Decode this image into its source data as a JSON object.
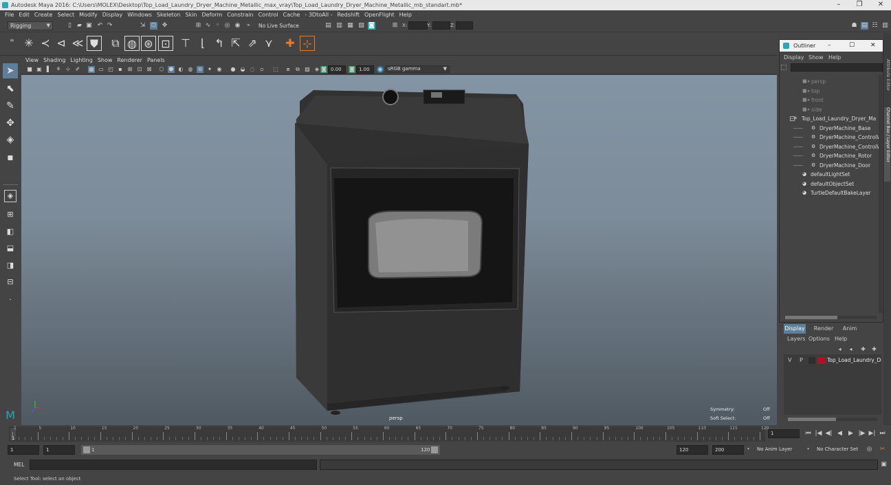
{
  "window": {
    "title": "Autodesk Maya 2016: C:\\Users\\MOLEX\\Desktop\\Top_Load_Laundry_Dryer_Machine_Metallic_max_vray\\Top_Load_Laundry_Dryer_Machine_Metallic_mb_standart.mb*"
  },
  "menu": [
    "File",
    "Edit",
    "Create",
    "Select",
    "Modify",
    "Display",
    "Windows",
    "Skeleton",
    "Skin",
    "Deform",
    "Constrain",
    "Control",
    "Cache",
    "- 3DtoAll -",
    "Redshift",
    "OpenFlight",
    "Help"
  ],
  "statusline": {
    "mode": "Rigging",
    "live_surface": "No Live Surface",
    "x_label": "X:",
    "y_label": "Y:",
    "z_label": "Z:"
  },
  "panel_menu": [
    "View",
    "Shading",
    "Lighting",
    "Show",
    "Renderer",
    "Panels"
  ],
  "panel_tools": {
    "exposure": "0.00",
    "gamma": "1.00",
    "colorspace": "sRGB gamma"
  },
  "viewport": {
    "camera": "persp",
    "symmetry_label": "Symmetry:",
    "symmetry_value": "Off",
    "soft_select_label": "Soft Select:",
    "soft_select_value": "Off"
  },
  "outliner": {
    "title": "Outliner",
    "menu": [
      "Display",
      "Show",
      "Help"
    ],
    "items": [
      {
        "label": "persp",
        "dim": true
      },
      {
        "label": "top",
        "dim": true
      },
      {
        "label": "front",
        "dim": true
      },
      {
        "label": "side",
        "dim": true
      },
      {
        "label": "Top_Load_Laundry_Dryer_Ma",
        "dim": false
      },
      {
        "label": "DryerMachine_Base",
        "dim": false
      },
      {
        "label": "DryerMachine_ControlW",
        "dim": false
      },
      {
        "label": "DryerMachine_ControlW",
        "dim": false
      },
      {
        "label": "DryerMachine_Rotor",
        "dim": false
      },
      {
        "label": "DryerMachine_Door",
        "dim": false
      },
      {
        "label": "defaultLightSet",
        "dim": false
      },
      {
        "label": "defaultObjectSet",
        "dim": false
      },
      {
        "label": "TurtleDefaultBakeLayer",
        "dim": false
      }
    ]
  },
  "right_strip": {
    "tab1": "Attribute Editor",
    "tab2": "Channel Box / Layer Editor"
  },
  "layer_editor": {
    "tabs": [
      "Display",
      "Render",
      "Anim"
    ],
    "menu": [
      "Layers",
      "Options",
      "Help"
    ],
    "layer": {
      "v": "V",
      "p": "P",
      "name": "Top_Load_Laundry_Dry",
      "color": "#b0102a"
    }
  },
  "timeline": {
    "ticks": [
      "1",
      "5",
      "10",
      "15",
      "20",
      "25",
      "30",
      "35",
      "40",
      "45",
      "50",
      "55",
      "60",
      "65",
      "70",
      "75",
      "80",
      "85",
      "90",
      "95",
      "100",
      "105",
      "110",
      "115",
      "120"
    ],
    "current_frame": "1"
  },
  "range": {
    "start": "1",
    "playback_start": "1",
    "slider_start": "1",
    "slider_end": "120",
    "playback_end": "120",
    "end": "200",
    "anim_layer": "No Anim Layer",
    "char_set": "No Character Set"
  },
  "cmdline": {
    "label": "MEL"
  },
  "helpline": {
    "text": "Select Tool: select an object"
  },
  "colors": {
    "accent": "#2aa6b8",
    "active_tab": "#5d7f9a",
    "layer_swatch": "#b0102a"
  }
}
